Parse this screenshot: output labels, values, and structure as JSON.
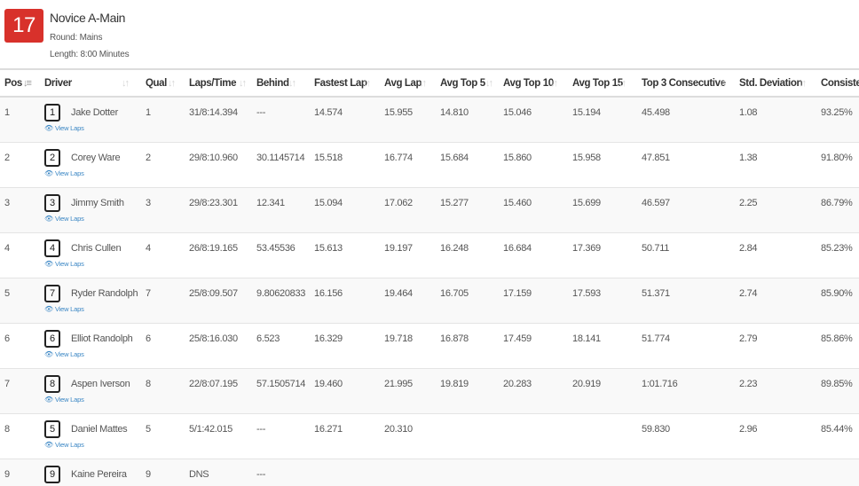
{
  "event": {
    "number": "17",
    "title": "Novice A-Main",
    "round": "Round: Mains",
    "length": "Length: 8:00 Minutes"
  },
  "columns": [
    {
      "key": "pos",
      "label": "Pos"
    },
    {
      "key": "driver",
      "label": "Driver"
    },
    {
      "key": "qual",
      "label": "Qual"
    },
    {
      "key": "laps_time",
      "label": "Laps/Time"
    },
    {
      "key": "behind",
      "label": "Behind"
    },
    {
      "key": "fastest_lap",
      "label": "Fastest Lap"
    },
    {
      "key": "avg_lap",
      "label": "Avg Lap"
    },
    {
      "key": "avg_top5",
      "label": "Avg Top 5"
    },
    {
      "key": "avg_top10",
      "label": "Avg Top 10"
    },
    {
      "key": "avg_top15",
      "label": "Avg Top 15"
    },
    {
      "key": "top3_consecutive",
      "label": "Top 3 Consecutive"
    },
    {
      "key": "std_deviation",
      "label": "Std. Deviation"
    },
    {
      "key": "consistency",
      "label": "Consisten"
    }
  ],
  "view_laps_label": "View Laps",
  "rows": [
    {
      "pos": "1",
      "car": "1",
      "driver": "Jake Dotter",
      "qual": "1",
      "laps_time": "31/8:14.394",
      "behind": "---",
      "fastest_lap": "14.574",
      "avg_lap": "15.955",
      "avg_top5": "14.810",
      "avg_top10": "15.046",
      "avg_top15": "15.194",
      "top3_consecutive": "45.498",
      "std_deviation": "1.08",
      "consistency": "93.25%"
    },
    {
      "pos": "2",
      "car": "2",
      "driver": "Corey Ware",
      "qual": "2",
      "laps_time": "29/8:10.960",
      "behind": "30.1145714",
      "fastest_lap": "15.518",
      "avg_lap": "16.774",
      "avg_top5": "15.684",
      "avg_top10": "15.860",
      "avg_top15": "15.958",
      "top3_consecutive": "47.851",
      "std_deviation": "1.38",
      "consistency": "91.80%"
    },
    {
      "pos": "3",
      "car": "3",
      "driver": "Jimmy Smith",
      "qual": "3",
      "laps_time": "29/8:23.301",
      "behind": "12.341",
      "fastest_lap": "15.094",
      "avg_lap": "17.062",
      "avg_top5": "15.277",
      "avg_top10": "15.460",
      "avg_top15": "15.699",
      "top3_consecutive": "46.597",
      "std_deviation": "2.25",
      "consistency": "86.79%"
    },
    {
      "pos": "4",
      "car": "4",
      "driver": "Chris Cullen",
      "qual": "4",
      "laps_time": "26/8:19.165",
      "behind": "53.45536",
      "fastest_lap": "15.613",
      "avg_lap": "19.197",
      "avg_top5": "16.248",
      "avg_top10": "16.684",
      "avg_top15": "17.369",
      "top3_consecutive": "50.711",
      "std_deviation": "2.84",
      "consistency": "85.23%"
    },
    {
      "pos": "5",
      "car": "7",
      "driver": "Ryder Randolph",
      "qual": "7",
      "laps_time": "25/8:09.507",
      "behind": "9.80620833",
      "fastest_lap": "16.156",
      "avg_lap": "19.464",
      "avg_top5": "16.705",
      "avg_top10": "17.159",
      "avg_top15": "17.593",
      "top3_consecutive": "51.371",
      "std_deviation": "2.74",
      "consistency": "85.90%"
    },
    {
      "pos": "6",
      "car": "6",
      "driver": "Elliot Randolph",
      "qual": "6",
      "laps_time": "25/8:16.030",
      "behind": "6.523",
      "fastest_lap": "16.329",
      "avg_lap": "19.718",
      "avg_top5": "16.878",
      "avg_top10": "17.459",
      "avg_top15": "18.141",
      "top3_consecutive": "51.774",
      "std_deviation": "2.79",
      "consistency": "85.86%"
    },
    {
      "pos": "7",
      "car": "8",
      "driver": "Aspen Iverson",
      "qual": "8",
      "laps_time": "22/8:07.195",
      "behind": "57.1505714",
      "fastest_lap": "19.460",
      "avg_lap": "21.995",
      "avg_top5": "19.819",
      "avg_top10": "20.283",
      "avg_top15": "20.919",
      "top3_consecutive": "1:01.716",
      "std_deviation": "2.23",
      "consistency": "89.85%"
    },
    {
      "pos": "8",
      "car": "5",
      "driver": "Daniel Mattes",
      "qual": "5",
      "laps_time": "5/1:42.015",
      "behind": "---",
      "fastest_lap": "16.271",
      "avg_lap": "20.310",
      "avg_top5": "",
      "avg_top10": "",
      "avg_top15": "",
      "top3_consecutive": "59.830",
      "std_deviation": "2.96",
      "consistency": "85.44%"
    },
    {
      "pos": "9",
      "car": "9",
      "driver": "Kaine Pereira",
      "qual": "9",
      "laps_time": "DNS",
      "behind": "---",
      "fastest_lap": "",
      "avg_lap": "",
      "avg_top5": "",
      "avg_top10": "",
      "avg_top15": "",
      "top3_consecutive": "",
      "std_deviation": "",
      "consistency": ""
    }
  ]
}
